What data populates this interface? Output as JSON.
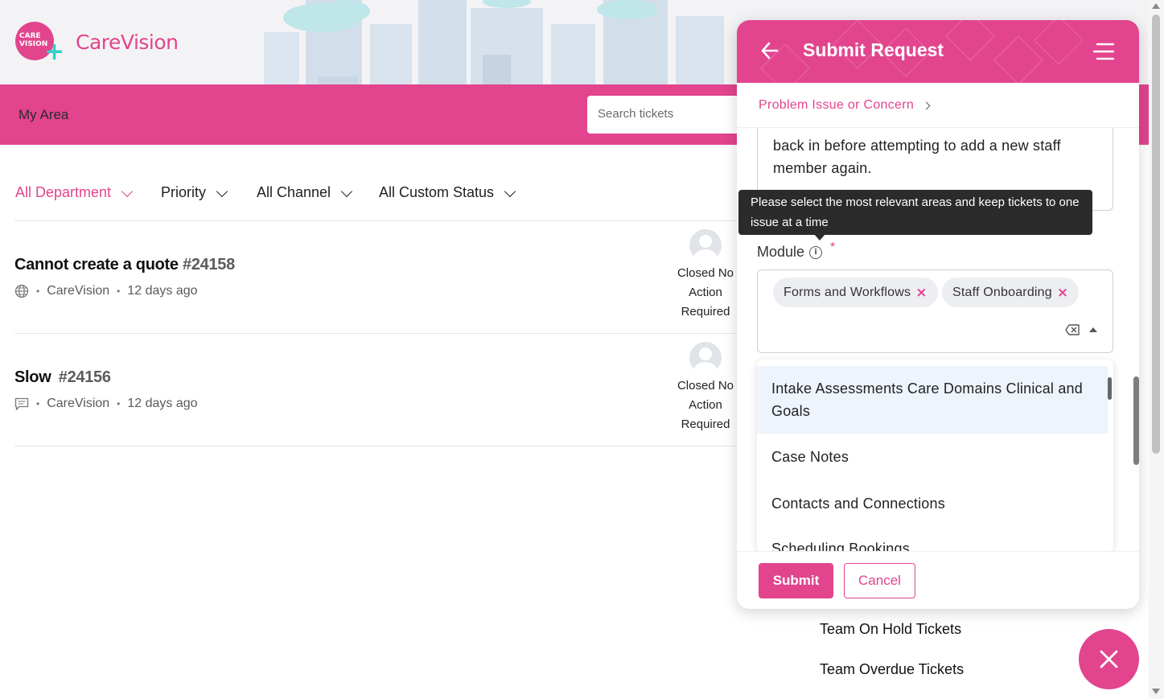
{
  "brand": {
    "logo_text": "CARE VISION",
    "name": "CareVision"
  },
  "header": {
    "my_area": "My Area",
    "search_placeholder": "Search tickets"
  },
  "filters": [
    {
      "label": "All Department",
      "active": true
    },
    {
      "label": "Priority",
      "active": false
    },
    {
      "label": "All Channel",
      "active": false
    },
    {
      "label": "All Custom Status",
      "active": false
    }
  ],
  "tickets": [
    {
      "title": "Cannot create a quote",
      "id": "#24158",
      "channel_icon": "globe-icon",
      "company": "CareVision",
      "age": "12 days ago",
      "status_lines": [
        "Closed No",
        "Action",
        "Required"
      ]
    },
    {
      "title": "Slow",
      "id": "#24156",
      "channel_icon": "feedback-icon",
      "company": "CareVision",
      "age": "12 days ago",
      "status_lines": [
        "Closed No",
        "Action",
        "Required"
      ]
    }
  ],
  "team_links": [
    "Team On Hold Tickets",
    "Team Overdue Tickets"
  ],
  "panel": {
    "title": "Submit Request",
    "breadcrumb": "Problem Issue or Concern",
    "description_lines": [
      "back in before attempting to add a new staff",
      "member again."
    ],
    "tooltip": "Please select the most relevant areas and keep tickets to one issue at a time",
    "module_label": "Module",
    "required_mark": "*",
    "selected_modules": [
      "Forms and Workflows",
      "Staff Onboarding"
    ],
    "options": [
      "Intake Assessments Care Domains Clinical and Goals",
      "Case Notes",
      "Contacts and Connections",
      "Scheduling Bookings"
    ],
    "submit_label": "Submit",
    "cancel_label": "Cancel"
  },
  "colors": {
    "brand": "#e2448e",
    "accent_teal": "#2dd1c9",
    "highlight": "#eef4fc"
  }
}
